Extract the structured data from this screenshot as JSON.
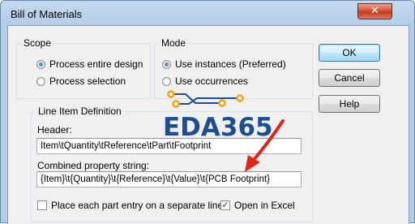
{
  "window": {
    "title": "Bill of Materials",
    "close_glyph": "✕"
  },
  "scope": {
    "legend": "Scope",
    "options": [
      {
        "label": "Process entire design",
        "selected": true
      },
      {
        "label": "Process selection",
        "selected": false
      }
    ]
  },
  "mode": {
    "legend": "Mode",
    "options": [
      {
        "label": "Use instances (Preferred)",
        "selected": true
      },
      {
        "label": "Use occurrences",
        "selected": false
      }
    ]
  },
  "line_item": {
    "legend": "Line Item Definition",
    "header_label": "Header:",
    "header_value": "Item\\tQuantity\\tReference\\tPart\\tFootprint",
    "combined_label": "Combined property string:",
    "combined_value": "{Item}\\t{Quantity}\\t{Reference}\\t{Value}\\t{PCB Footprint}",
    "separate_line_label": "Place each part entry on a separate line",
    "separate_line_checked": false,
    "open_excel_label": "Open in Excel",
    "open_excel_checked": true
  },
  "buttons": {
    "ok": "OK",
    "cancel": "Cancel",
    "help": "Help"
  },
  "watermark": {
    "text": "EDA365",
    "logo": "circuit-trace-logo"
  },
  "annotation": {
    "arrow_color": "#e0241a"
  },
  "colors": {
    "watermark": "#1f4e8c",
    "logo_trace": "#1f4e8c",
    "logo_pad": "#f2a20a"
  }
}
